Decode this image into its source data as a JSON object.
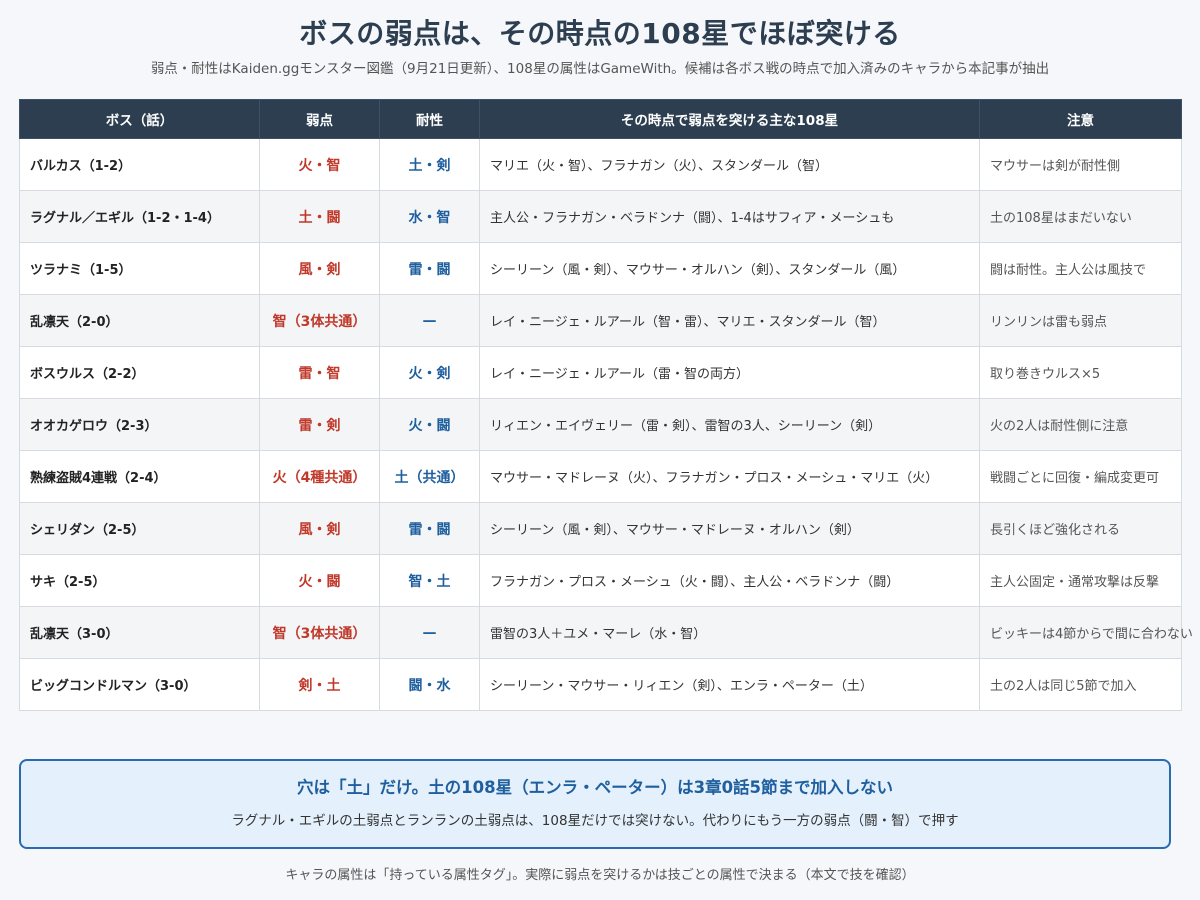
{
  "title": "ボスの弱点は、その時点の108星でほぼ突ける",
  "subtitle": "弱点・耐性はKaiden.ggモンスター図鑑（9月21日更新）、108星の属性はGameWith。候補は各ボス戦の時点で加入済みのキャラから本記事が抽出",
  "table": {
    "headers": [
      "ボス（話）",
      "弱点",
      "耐性",
      "その時点で弱点を突ける主な108星",
      "注意"
    ],
    "rows": [
      {
        "boss": "バルカス（1-2）",
        "weak": "火・智",
        "resist": "土・剣",
        "chars": "マリエ（火・智）、フラナガン（火）、スタンダール（智）",
        "note": "マウサーは剣が耐性側"
      },
      {
        "boss": "ラグナル／エギル（1-2・1-4）",
        "weak": "土・闘",
        "resist": "水・智",
        "chars": "主人公・フラナガン・ベラドンナ（闘）、1-4はサフィア・メーシュも",
        "note": "土の108星はまだいない"
      },
      {
        "boss": "ツラナミ（1-5）",
        "weak": "風・剣",
        "resist": "雷・闘",
        "chars": "シーリーン（風・剣）、マウサー・オルハン（剣）、スタンダール（風）",
        "note": "闘は耐性。主人公は風技で"
      },
      {
        "boss": "乱凛天（2-0）",
        "weak": "智（3体共通）",
        "resist": "—",
        "chars": "レイ・ニージェ・ルアール（智・雷）、マリエ・スタンダール（智）",
        "note": "リンリンは雷も弱点"
      },
      {
        "boss": "ボスウルス（2-2）",
        "weak": "雷・智",
        "resist": "火・剣",
        "chars": "レイ・ニージェ・ルアール（雷・智の両方）",
        "note": "取り巻きウルス×5"
      },
      {
        "boss": "オオカゲロウ（2-3）",
        "weak": "雷・剣",
        "resist": "火・闘",
        "chars": "リィエン・エイヴェリー（雷・剣）、雷智の3人、シーリーン（剣）",
        "note": "火の2人は耐性側に注意"
      },
      {
        "boss": "熟練盗賊4連戦（2-4）",
        "weak": "火（4種共通）",
        "resist": "土（共通）",
        "chars": "マウサー・マドレーヌ（火）、フラナガン・プロス・メーシュ・マリエ（火）",
        "note": "戦闘ごとに回復・編成変更可"
      },
      {
        "boss": "シェリダン（2-5）",
        "weak": "風・剣",
        "resist": "雷・闘",
        "chars": "シーリーン（風・剣）、マウサー・マドレーヌ・オルハン（剣）",
        "note": "長引くほど強化される"
      },
      {
        "boss": "サキ（2-5）",
        "weak": "火・闘",
        "resist": "智・土",
        "chars": "フラナガン・プロス・メーシュ（火・闘）、主人公・ベラドンナ（闘）",
        "note": "主人公固定・通常攻撃は反撃"
      },
      {
        "boss": "乱凛天（3-0）",
        "weak": "智（3体共通）",
        "resist": "—",
        "chars": "雷智の3人＋ユメ・マーレ（水・智）",
        "note": "ビッキーは4節からで間に合わない"
      },
      {
        "boss": "ビッグコンドルマン（3-0）",
        "weak": "剣・土",
        "resist": "闘・水",
        "chars": "シーリーン・マウサー・リィエン（剣）、エンラ・ペーター（土）",
        "note": "土の2人は同じ5節で加入"
      }
    ]
  },
  "callout": {
    "title": "穴は「土」だけ。土の108星（エンラ・ペーター）は3章0話5節まで加入しない",
    "body": "ラグナル・エギルの土弱点とランランの土弱点は、108星だけでは突けない。代わりにもう一方の弱点（闘・智）で押す"
  },
  "footer": "キャラの属性は「持っている属性タグ」。実際に弱点を突けるかは技ごとの属性で決まる（本文で技を確認）",
  "colors": {
    "header_bg": "#2c3e50",
    "weak": "#c0392b",
    "resist": "#1f5f9e",
    "callout_bg": "#e4f0fb",
    "callout_border": "#2a6bb0"
  }
}
